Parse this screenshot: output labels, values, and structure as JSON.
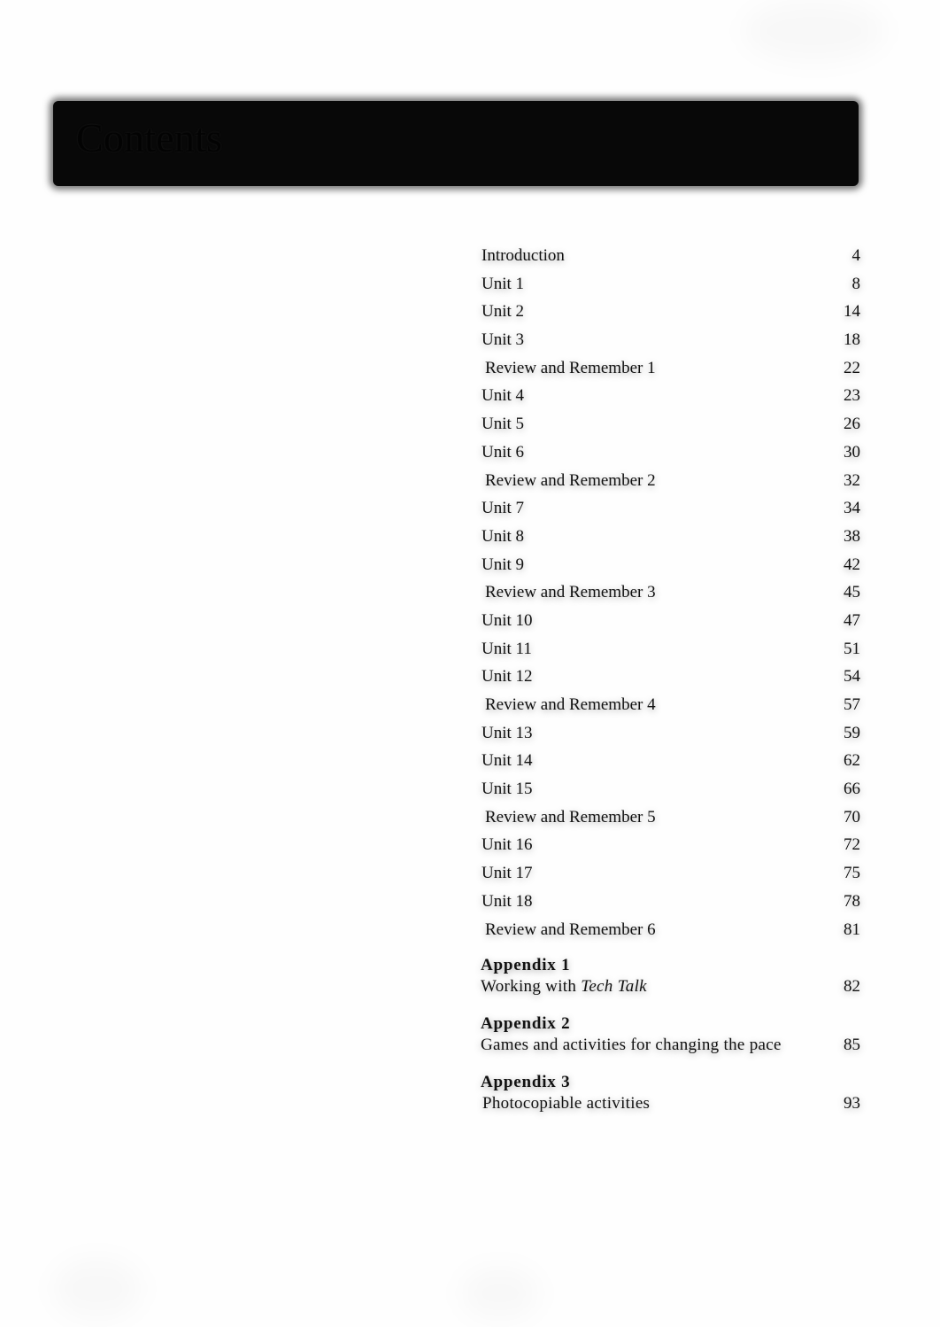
{
  "header": {
    "title": "Contents"
  },
  "toc": {
    "entries": [
      {
        "label": "Introduction",
        "page": "4",
        "type": "intro"
      },
      {
        "label": "Unit 1",
        "page": "8",
        "type": "unit"
      },
      {
        "label": "Unit 2",
        "page": "14",
        "type": "unit"
      },
      {
        "label": "Unit 3",
        "page": "18",
        "type": "unit"
      },
      {
        "label": "Review and Remember 1",
        "page": "22",
        "type": "review"
      },
      {
        "label": "Unit 4",
        "page": "23",
        "type": "unit"
      },
      {
        "label": "Unit 5",
        "page": "26",
        "type": "unit"
      },
      {
        "label": "Unit 6",
        "page": "30",
        "type": "unit"
      },
      {
        "label": "Review and Remember 2",
        "page": "32",
        "type": "review"
      },
      {
        "label": "Unit 7",
        "page": "34",
        "type": "unit"
      },
      {
        "label": "Unit 8",
        "page": "38",
        "type": "unit"
      },
      {
        "label": "Unit 9",
        "page": "42",
        "type": "unit"
      },
      {
        "label": "Review and Remember 3",
        "page": "45",
        "type": "review"
      },
      {
        "label": "Unit 10",
        "page": "47",
        "type": "unit"
      },
      {
        "label": "Unit 11",
        "page": "51",
        "type": "unit"
      },
      {
        "label": "Unit 12",
        "page": "54",
        "type": "unit"
      },
      {
        "label": "Review and Remember 4",
        "page": "57",
        "type": "review"
      },
      {
        "label": "Unit 13",
        "page": "59",
        "type": "unit"
      },
      {
        "label": "Unit 14",
        "page": "62",
        "type": "unit"
      },
      {
        "label": "Unit 15",
        "page": "66",
        "type": "unit"
      },
      {
        "label": "Review and Remember 5",
        "page": "70",
        "type": "review"
      },
      {
        "label": "Unit 16",
        "page": "72",
        "type": "unit"
      },
      {
        "label": "Unit 17",
        "page": "75",
        "type": "unit"
      },
      {
        "label": "Unit 18",
        "page": "78",
        "type": "unit"
      },
      {
        "label": "Review and Remember 6",
        "page": "81",
        "type": "review"
      }
    ],
    "appendices": [
      {
        "heading": "Appendix 1",
        "title_prefix": "Working with ",
        "title_italic": "Tech Talk",
        "page": "82"
      },
      {
        "heading": "Appendix 2",
        "title_prefix": "Games and activities for changing the pace",
        "title_italic": "",
        "page": "85"
      },
      {
        "heading": "Appendix 3",
        "title_prefix": "Photocopiable activities",
        "title_italic": "",
        "page": "93"
      }
    ]
  }
}
